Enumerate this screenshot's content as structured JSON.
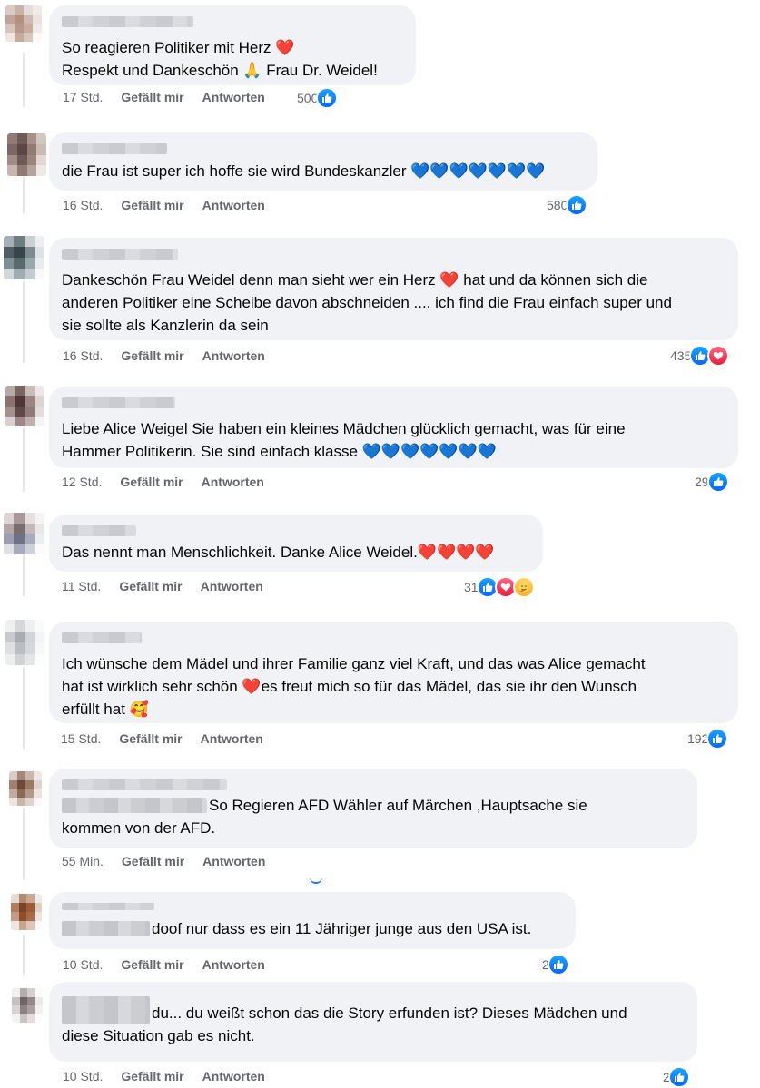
{
  "actions": {
    "like": "Gefällt mir",
    "reply": "Antworten"
  },
  "colors": {
    "like": "#1877f2",
    "love": "#e41e3f",
    "bubble": "#f0f2f5",
    "meta": "#65676b"
  },
  "comments": [
    {
      "lines": [
        "So reagieren Politiker mit Herz ❤️",
        "Respekt und Dankeschön 🙏 Frau Dr. Weidel!"
      ],
      "time": "17 Std.",
      "count": "500",
      "reactions": [
        "like"
      ]
    },
    {
      "lines": [
        "die Frau ist super ich hoffe sie wird Bundeskanzler 💙💙💙💙💙💙💙"
      ],
      "time": "16 Std.",
      "count": "580",
      "reactions": [
        "like"
      ]
    },
    {
      "lines": [
        "Dankeschön Frau Weidel denn man sieht wer ein Herz ❤️ hat und da können sich die",
        "anderen Politiker eine Scheibe davon abschneiden .... ich find die Frau einfach super und",
        "sie sollte als Kanzlerin da sein"
      ],
      "time": "16 Std.",
      "count": "435",
      "reactions": [
        "like",
        "love"
      ]
    },
    {
      "lines": [
        "Liebe Alice Weigel Sie haben ein kleines Mädchen glücklich gemacht, was für eine",
        "Hammer Politikerin. Sie sind einfach klasse 💙💙💙💙💙💙💙"
      ],
      "time": "12 Std.",
      "count": "29",
      "reactions": [
        "like"
      ]
    },
    {
      "lines": [
        "Das nennt man Menschlichkeit. Danke Alice Weidel.❤️❤️❤️❤️"
      ],
      "time": "11 Std.",
      "count": "31",
      "reactions": [
        "like",
        "love",
        "care"
      ]
    },
    {
      "lines": [
        "Ich wünsche dem Mädel und ihrer Familie ganz viel Kraft, und das was Alice gemacht",
        "hat ist wirklich sehr schön ❤️es freut mich so für das Mädel, das sie ihr den Wunsch",
        "erfüllt hat 🥰"
      ],
      "time": "15 Std.",
      "count": "192",
      "reactions": [
        "like"
      ]
    },
    {
      "lines": [
        "So Regieren AFD Wähler auf Märchen ,Hauptsache sie",
        "kommen von der AFD."
      ],
      "time": "55 Min.",
      "count": "",
      "reactions": []
    },
    {
      "lines": [
        "doof nur dass es ein 11 Jähriger junge aus den USA ist."
      ],
      "time": "10 Std.",
      "count": "2",
      "reactions": [
        "like"
      ]
    },
    {
      "lines": [
        "du... du weißt schon das die Story erfunden ist? Dieses Mädchen und",
        "diese Situation gab es nicht."
      ],
      "time": "10 Std.",
      "count": "2",
      "reactions": [
        "like"
      ]
    }
  ]
}
